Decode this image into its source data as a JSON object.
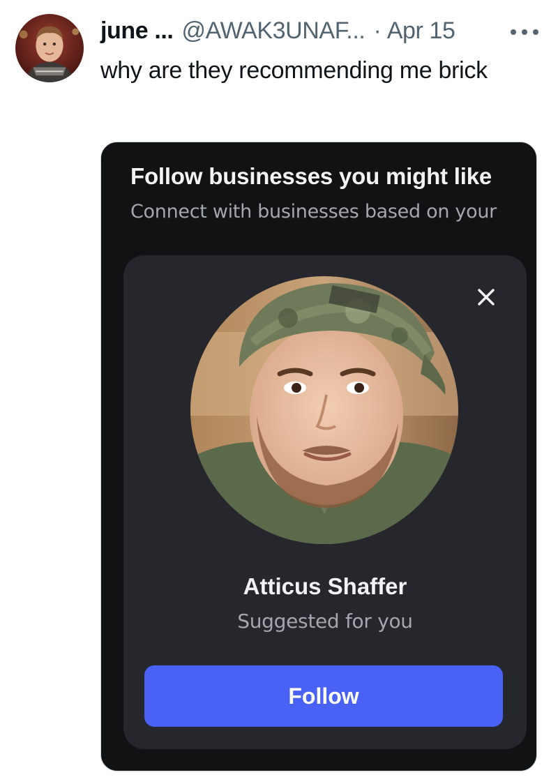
{
  "tweet": {
    "display_name": "june ...",
    "handle": "@AWAK3UNAF...",
    "separator": "·",
    "date": "Apr 15",
    "text": "why are they recommending me brick"
  },
  "media": {
    "title": "Follow businesses you might like",
    "subtitle": "Connect with businesses based on your",
    "card": {
      "name": "Atticus Shaffer",
      "suggestion": "Suggested for you",
      "follow_label": "Follow"
    }
  },
  "icons": {
    "more": "more-horizontal-icon",
    "close": "close-icon"
  },
  "colors": {
    "text_primary": "#0f1419",
    "text_secondary": "#536471",
    "media_bg": "#101214",
    "card_bg": "#25272c",
    "follow_button": "#4a61f5"
  }
}
